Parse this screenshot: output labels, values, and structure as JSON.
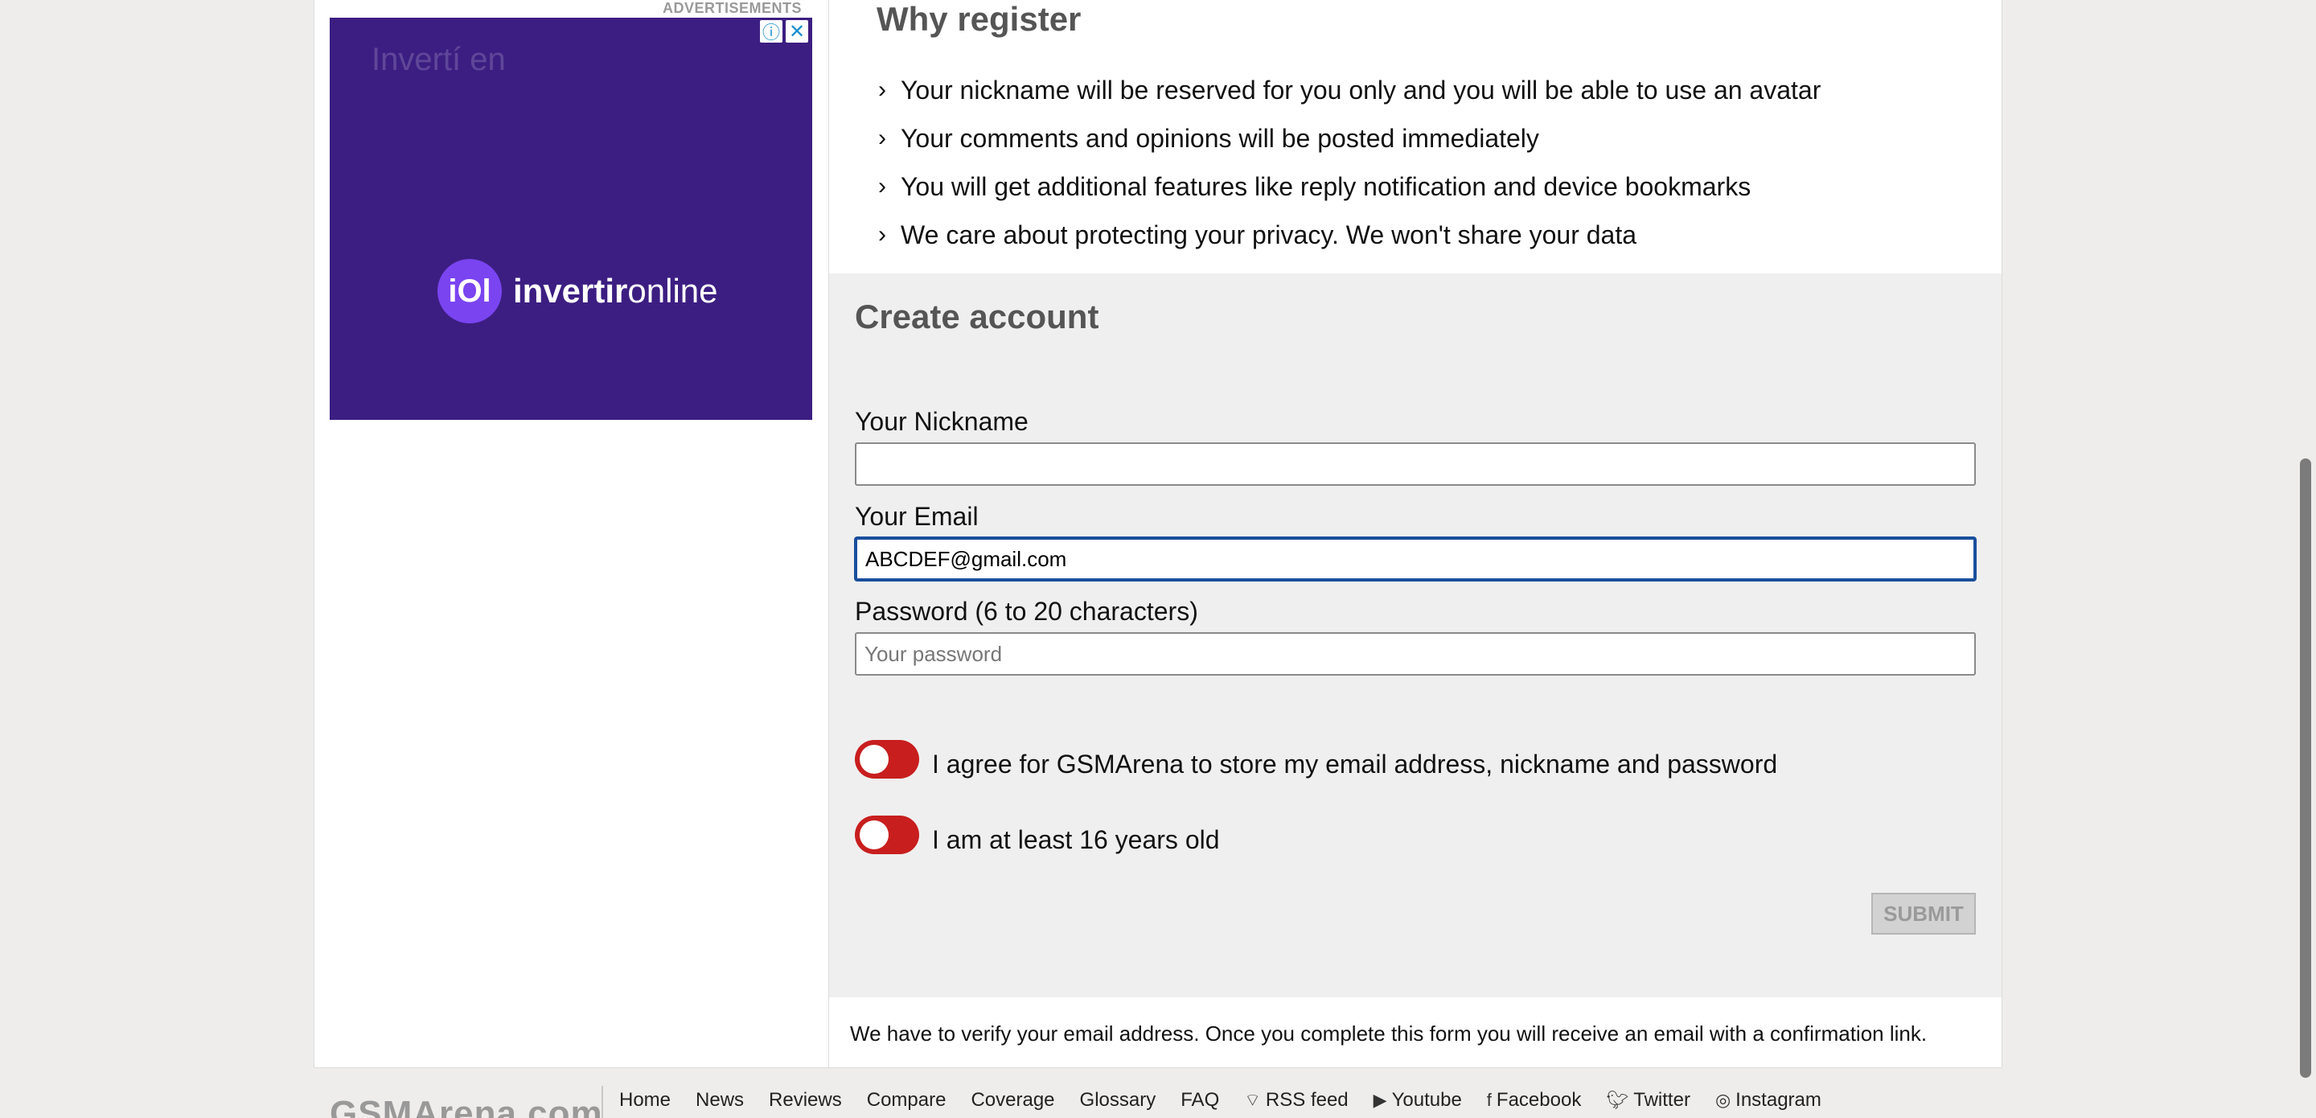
{
  "ad": {
    "label": "ADVERTISEMENTS",
    "teaser": "Invertí en",
    "logo_mark": "iOl",
    "logo_bold": "invertir",
    "logo_light": "online",
    "info_glyph": "ⓘ",
    "close_glyph": "✕"
  },
  "why_register": {
    "title": "Why register",
    "items": [
      "Your nickname will be reserved for you only and you will be able to use an avatar",
      "Your comments and opinions will be posted immediately",
      "You will get additional features like reply notification and device bookmarks",
      "We care about protecting your privacy. We won't share your data"
    ]
  },
  "create_account": {
    "title": "Create account",
    "nickname_label": "Your Nickname",
    "nickname_value": "",
    "email_label": "Your Email",
    "email_value": "ABCDEF@gmail.com",
    "password_label": "Password (6 to 20 characters)",
    "password_placeholder": "Your password",
    "agree_label": "I agree for GSMArena to store my email address, nickname and password",
    "age_label": "I am at least 16 years old",
    "submit_label": "SUBMIT"
  },
  "verify_note": "We have to verify your email address. Once you complete this form you will receive an email with a confirmation link.",
  "footer": {
    "logo": "GSMArena.com",
    "links": [
      {
        "label": "Home",
        "icon": ""
      },
      {
        "label": "News",
        "icon": ""
      },
      {
        "label": "Reviews",
        "icon": ""
      },
      {
        "label": "Compare",
        "icon": ""
      },
      {
        "label": "Coverage",
        "icon": ""
      },
      {
        "label": "Glossary",
        "icon": ""
      },
      {
        "label": "FAQ",
        "icon": ""
      },
      {
        "label": "RSS feed",
        "icon": "rss-icon"
      },
      {
        "label": "Youtube",
        "icon": "youtube-icon"
      },
      {
        "label": "Facebook",
        "icon": "facebook-icon"
      },
      {
        "label": "Twitter",
        "icon": "twitter-icon"
      },
      {
        "label": "Instagram",
        "icon": "instagram-icon"
      }
    ]
  },
  "colors": {
    "toggle_off": "#c81e1e",
    "ad_background": "#3c1e82",
    "focus_border": "#1a4f9c"
  }
}
